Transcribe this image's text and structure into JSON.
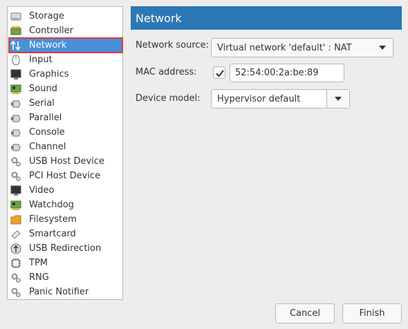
{
  "sidebar": {
    "items": [
      {
        "label": "Storage",
        "icon": "storage-icon"
      },
      {
        "label": "Controller",
        "icon": "controller-icon"
      },
      {
        "label": "Network",
        "icon": "network-icon"
      },
      {
        "label": "Input",
        "icon": "mouse-icon"
      },
      {
        "label": "Graphics",
        "icon": "monitor-icon"
      },
      {
        "label": "Sound",
        "icon": "sound-card-icon"
      },
      {
        "label": "Serial",
        "icon": "serial-plug-icon"
      },
      {
        "label": "Parallel",
        "icon": "parallel-plug-icon"
      },
      {
        "label": "Console",
        "icon": "console-plug-icon"
      },
      {
        "label": "Channel",
        "icon": "channel-plug-icon"
      },
      {
        "label": "USB Host Device",
        "icon": "usb-gear-icon"
      },
      {
        "label": "PCI Host Device",
        "icon": "pci-gear-icon"
      },
      {
        "label": "Video",
        "icon": "video-monitor-icon"
      },
      {
        "label": "Watchdog",
        "icon": "watchdog-card-icon"
      },
      {
        "label": "Filesystem",
        "icon": "folder-icon"
      },
      {
        "label": "Smartcard",
        "icon": "smartcard-icon"
      },
      {
        "label": "USB Redirection",
        "icon": "usb-redirection-icon"
      },
      {
        "label": "TPM",
        "icon": "chip-icon"
      },
      {
        "label": "RNG",
        "icon": "rng-gear-icon"
      },
      {
        "label": "Panic Notifier",
        "icon": "panic-gear-icon"
      }
    ],
    "selected_index": 2
  },
  "header": {
    "title": "Network"
  },
  "form": {
    "network_source_label": "Network source:",
    "network_source_value": "Virtual network 'default' : NAT",
    "mac_label": "MAC address:",
    "mac_checked": true,
    "mac_value": "52:54:00:2a:be:89",
    "device_model_label": "Device model:",
    "device_model_value": "Hypervisor default"
  },
  "buttons": {
    "cancel": "Cancel",
    "finish": "Finish"
  },
  "colors": {
    "header_bg": "#2c78b5",
    "selection_bg": "#4a90d9",
    "selection_outline": "#e53935"
  }
}
